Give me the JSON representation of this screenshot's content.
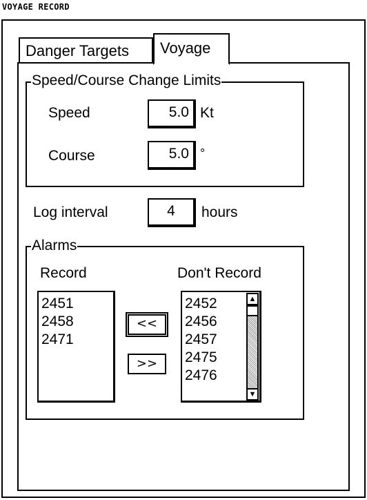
{
  "window": {
    "title": "VOYAGE RECORD"
  },
  "tabs": [
    {
      "label": "Danger Targets"
    },
    {
      "label": "Voyage"
    }
  ],
  "limits": {
    "legend": "Speed/Course Change Limits",
    "speed": {
      "label": "Speed",
      "value": "5.0",
      "unit": "Kt"
    },
    "course": {
      "label": "Course",
      "value": "5.0",
      "unit": "°"
    }
  },
  "log": {
    "label": "Log interval",
    "value": "4",
    "unit": "hours"
  },
  "alarms": {
    "legend": "Alarms",
    "record_label": "Record",
    "dont_record_label": "Don't Record",
    "record": [
      "2451",
      "2458",
      "2471"
    ],
    "dont_record": [
      "2452",
      "2456",
      "2457",
      "2475",
      "2476"
    ],
    "move_left_label": "<<",
    "move_right_label": ">>"
  },
  "scrollbar": {
    "up_icon": "up-arrow-icon",
    "down_icon": "down-arrow-icon"
  }
}
